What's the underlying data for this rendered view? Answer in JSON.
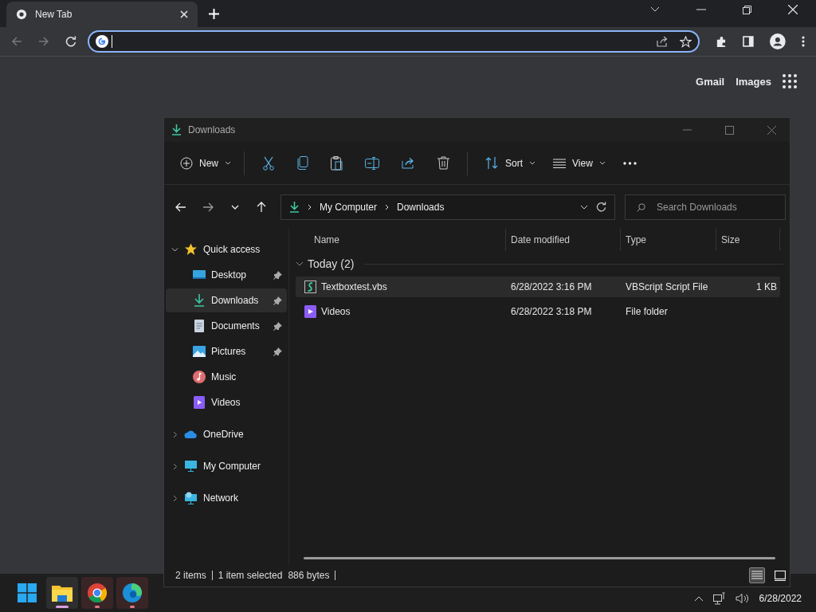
{
  "browser": {
    "tab": {
      "title": "New Tab"
    },
    "links": [
      "Gmail",
      "Images"
    ]
  },
  "explorer": {
    "title": "Downloads",
    "toolbar": {
      "new": "New",
      "sort": "Sort",
      "view": "View"
    },
    "path": [
      "My Computer",
      "Downloads"
    ],
    "search": {
      "placeholder": "Search Downloads"
    },
    "sidebar": [
      {
        "label": "Quick access",
        "kind": "star",
        "expanded": true,
        "selected": false,
        "children": [
          {
            "label": "Desktop",
            "kind": "desktop",
            "pinned": true,
            "selected": false
          },
          {
            "label": "Downloads",
            "kind": "download",
            "pinned": true,
            "selected": true
          },
          {
            "label": "Documents",
            "kind": "document",
            "pinned": true,
            "selected": false
          },
          {
            "label": "Pictures",
            "kind": "picture",
            "pinned": true,
            "selected": false
          },
          {
            "label": "Music",
            "kind": "music",
            "pinned": false,
            "selected": false
          },
          {
            "label": "Videos",
            "kind": "video",
            "pinned": false,
            "selected": false
          }
        ]
      },
      {
        "label": "OneDrive",
        "kind": "cloud",
        "expanded": false,
        "selected": false
      },
      {
        "label": "My Computer",
        "kind": "monitor",
        "expanded": false,
        "selected": false
      },
      {
        "label": "Network",
        "kind": "network",
        "expanded": false,
        "selected": false
      }
    ],
    "columns": [
      "Name",
      "Date modified",
      "Type",
      "Size"
    ],
    "group": {
      "label": "Today (2)",
      "expanded": true
    },
    "files": [
      {
        "name": "Textboxtest.vbs",
        "kind": "script",
        "date": "6/28/2022 3:16 PM",
        "type": "VBScript Script File",
        "size": "1 KB",
        "selected": true
      },
      {
        "name": "Videos",
        "kind": "video",
        "date": "6/28/2022 3:18 PM",
        "type": "File folder",
        "selected": false
      }
    ],
    "status": {
      "count": "2 items",
      "selection": "1 item selected",
      "bytes": "886 bytes"
    },
    "views": [
      {
        "kind": "details",
        "selected": true
      },
      {
        "kind": "tiles",
        "selected": false
      }
    ]
  },
  "taskbar": {
    "apps": [
      {
        "kind": "start",
        "active": false,
        "running": false
      },
      {
        "kind": "explorer",
        "active": true,
        "running": true
      },
      {
        "kind": "chrome",
        "active": false,
        "running": true
      },
      {
        "kind": "edge",
        "active": false,
        "running": true
      }
    ],
    "clock": {
      "date": "6/28/2022"
    }
  }
}
